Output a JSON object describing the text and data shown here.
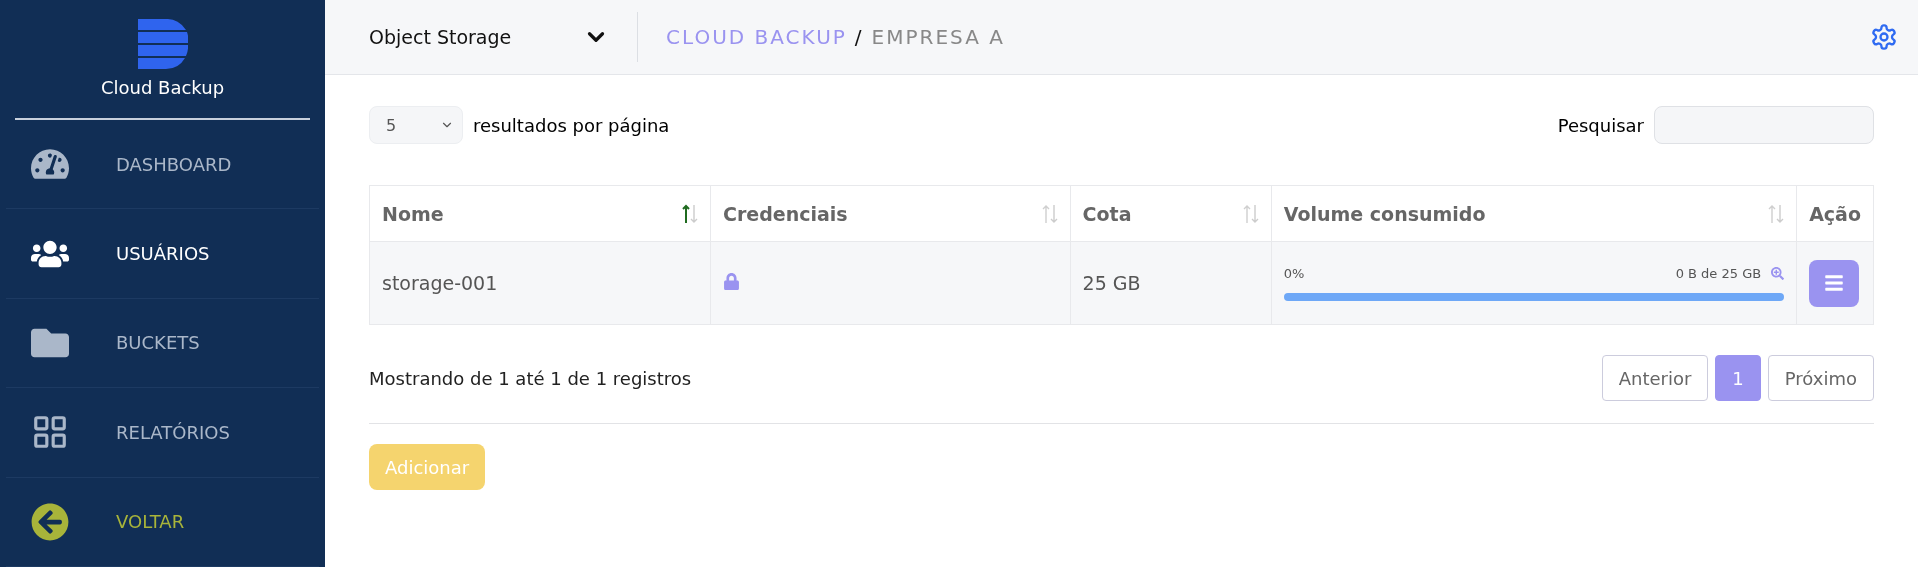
{
  "sidebar": {
    "brand": "Cloud Backup",
    "items": [
      {
        "label": "DASHBOARD",
        "kind": "nav",
        "selected": false
      },
      {
        "label": "USUÁRIOS",
        "kind": "nav",
        "selected": true
      },
      {
        "label": "BUCKETS",
        "kind": "nav",
        "selected": false
      },
      {
        "label": "RELATÓRIOS",
        "kind": "nav",
        "selected": false
      },
      {
        "label": "VOLTAR",
        "kind": "back",
        "selected": false
      }
    ]
  },
  "header": {
    "service": "Object Storage",
    "breadcrumb": [
      "CLOUD BACKUP",
      "/",
      "EMPRESA A"
    ]
  },
  "controls": {
    "page_size": "5",
    "page_size_label": "resultados por página",
    "search_label": "Pesquisar"
  },
  "table": {
    "columns": [
      {
        "label": "Nome",
        "kind": "sortable",
        "sorted": true
      },
      {
        "label": "Credenciais",
        "kind": "sortable",
        "sorted": false
      },
      {
        "label": "Cota",
        "kind": "sortable",
        "sorted": false
      },
      {
        "label": "Volume consumido",
        "kind": "sortable",
        "sorted": false
      },
      {
        "label": "Ação",
        "kind": "plain"
      }
    ],
    "rows": [
      {
        "name": "storage-001",
        "quota": "25 GB",
        "percent": "0%",
        "usage": "0 B de 25 GB",
        "level": 0
      }
    ]
  },
  "footer": {
    "info": "Mostrando de 1 até 1 de 1 registros",
    "prev": "Anterior",
    "pages": [
      {
        "label": "1",
        "selected": true
      }
    ],
    "next": "Próximo"
  },
  "add_button": "Adicionar"
}
